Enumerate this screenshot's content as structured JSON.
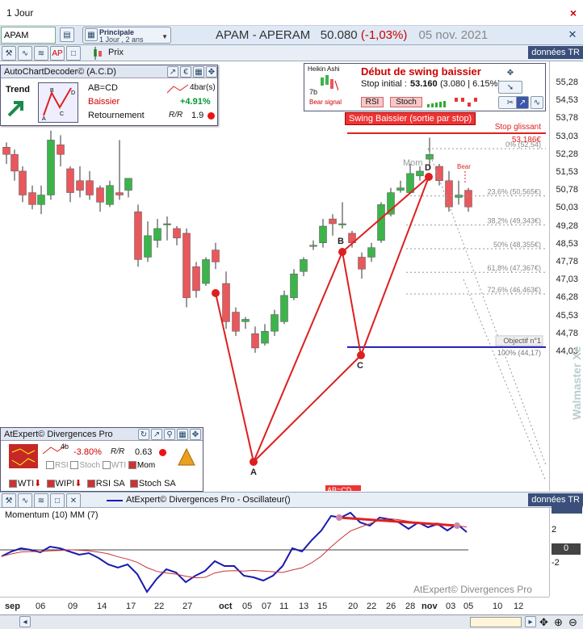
{
  "window": {
    "title": "1 Jour",
    "close_glyph": "×"
  },
  "symbol": {
    "input_value": "APAM",
    "period_line1": "Principale",
    "period_line2": "1 Jour , 2 ans"
  },
  "header": {
    "name": "APAM - APERAM",
    "price": "50.080",
    "change": "(-1,03%)",
    "date": "05 nov. 2021"
  },
  "toolbar": {
    "price_label": "Prix",
    "data_label": "données TR"
  },
  "yaxis": {
    "ticks": [
      "55,28",
      "54,53",
      "53,78",
      "53,03",
      "52,28",
      "51,53",
      "50,78",
      "50,03",
      "49,28",
      "48,53",
      "47,78",
      "47,03",
      "46,28",
      "45,53",
      "44,78",
      "44,03"
    ]
  },
  "acd": {
    "title": "AutoChartDecoder© (A.C.D)",
    "trend_label": "Trend",
    "pattern": "AB=CD",
    "direction": "Baissier",
    "status": "Retournement",
    "bars_label": "4bar(s)",
    "gain": "+4.91%",
    "ratio": "1.9"
  },
  "heikin": {
    "title": "Heikin Ashi",
    "count": "7b",
    "signal": "Bear signal",
    "headline": "Début de swing baissier",
    "stop_label": "Stop initial :",
    "stop_value": "53.160",
    "stop_detail": "(3.080 | 6.15%)",
    "rsi_btn": "RSI",
    "stoch_btn": "Stoch"
  },
  "swing_button": "Swing Baissier (sortie par stop)",
  "annotations": {
    "stop_glissant": "Stop glissant",
    "stop_value": "53.186€",
    "mom": "Mom",
    "bear": "Bear",
    "objectif": "Objectif n°1",
    "abcd_tag": "AB=CD"
  },
  "fib": [
    {
      "label": "0% (52,54)"
    },
    {
      "label": "23,6% (50,565€)"
    },
    {
      "label": "38,2% (49,343€)"
    },
    {
      "label": "50% (48,355€)"
    },
    {
      "label": "61,8% (47,367€)"
    },
    {
      "label": "72,6% (46,463€)"
    },
    {
      "label": "100% (44,17)"
    }
  ],
  "points": {
    "a": "A",
    "b": "B",
    "c": "C",
    "d": "D"
  },
  "divpro": {
    "title": "AtExpert© Divergences Pro",
    "bars": "4b",
    "pct": "-3.80%",
    "ratio": "0.63",
    "opts": [
      "RSI",
      "Stoch",
      "WTI",
      "Mom"
    ],
    "row2": [
      "WTI",
      "WIPI",
      "RSI SA",
      "Stoch SA"
    ]
  },
  "osc": {
    "title": "AtExpert© Divergences Pro - Oscillateur()",
    "subtitle": "Momentum (10) MM (7)",
    "y2": "2",
    "y0": "0",
    "ym2": "-2",
    "watermark": "AtExpert© Divergences Pro"
  },
  "xaxis": {
    "labels": [
      "sep",
      "06",
      "09",
      "14",
      "17",
      "22",
      "27",
      "oct",
      "05",
      "07",
      "11",
      "13",
      "15",
      "20",
      "22",
      "26",
      "28",
      "nov",
      "03",
      "05",
      "10",
      "12"
    ]
  },
  "brand": "Walmaster Xe",
  "colors": {
    "up": "#3cb44b",
    "down": "#e8585d",
    "pattern": "#dd1f1f",
    "blue": "#1a1ab0"
  }
}
